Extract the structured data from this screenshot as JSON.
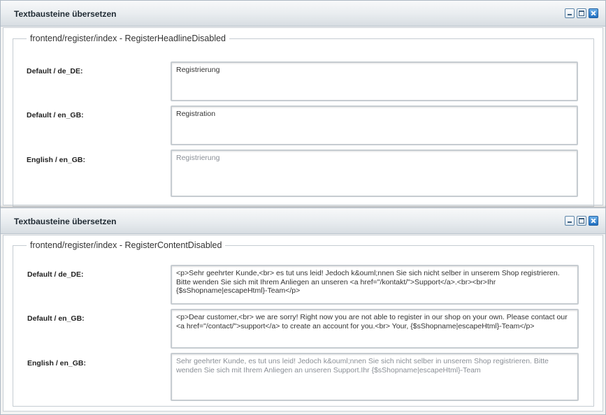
{
  "windows": [
    {
      "title": "Textbausteine übersetzen",
      "legend": "frontend/register/index - RegisterHeadlineDisabled",
      "rows": [
        {
          "label": "Default / de_DE:",
          "value": "Registrierung"
        },
        {
          "label": "Default / en_GB:",
          "value": "Registration"
        },
        {
          "label": "English / en_GB:",
          "value": "Registrierung"
        }
      ]
    },
    {
      "title": "Textbausteine übersetzen",
      "legend": "frontend/register/index - RegisterContentDisabled",
      "rows": [
        {
          "label": "Default / de_DE:",
          "value": "<p>Sehr geehrter Kunde,<br> es tut uns leid! Jedoch k&ouml;nnen Sie sich nicht selber in unserem Shop registrieren. Bitte wenden Sie sich mit Ihrem Anliegen an unseren <a href=\"/kontakt/\">Support</a>.<br><br>Ihr {$sShopname|escapeHtml}-Team</p>"
        },
        {
          "label": "Default / en_GB:",
          "value": "<p>Dear customer,<br> we are sorry! Right now you are not able to register in our shop on your own. Please contact our <a href=\"/contact/\">support</a> to create an account for you.<br> Your, {$sShopname|escapeHtml}-Team</p>"
        },
        {
          "label": "English / en_GB:",
          "value": "Sehr geehrter Kunde, es tut uns leid! Jedoch k&ouml;nnen Sie sich nicht selber in unserem Shop registrieren. Bitte wenden Sie sich mit Ihrem Anliegen an unseren Support.Ihr {$sShopname|escapeHtml}-Team"
        }
      ]
    }
  ],
  "window_controls": {
    "minimize": "minimize-icon",
    "maximize": "maximize-icon",
    "close": "close-icon"
  },
  "colors": {
    "title_bar": "#e8ecef",
    "close_button": "#1f6fc0",
    "placeholder_text": "#8a8f96"
  }
}
